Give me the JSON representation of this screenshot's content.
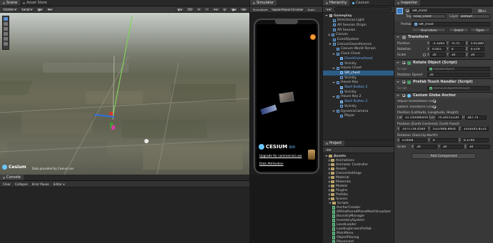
{
  "scene_panel": {
    "tabs": [
      "Scene",
      "Asset Store"
    ],
    "toolbar": [
      "Center",
      "Local"
    ],
    "view_2d": "2D",
    "attribution": "Data provided by Cesium ion",
    "cesium_logo": "Cesium"
  },
  "simulator_panel": {
    "tab": "Simulator",
    "device_label": "Simulator",
    "device": "Apple iPhone 12 mini",
    "scale_label": "Scale",
    "cesium_brand": "CESIUM",
    "ion": "ion",
    "upgrade_text": "Upgrade for commercial use",
    "data_attribution": "Data Attribution"
  },
  "hierarchy_panel": {
    "tab": "Hierarchy",
    "secondary_tab": "Cesium",
    "items": [
      {
        "label": "Gameplay",
        "depth": 0,
        "expanded": true,
        "kind": "scene",
        "bold": true
      },
      {
        "label": "Directional Light",
        "depth": 1,
        "kind": "go"
      },
      {
        "label": "AR Session Origin",
        "depth": 1,
        "kind": "go"
      },
      {
        "label": "AR Session",
        "depth": 1,
        "kind": "go"
      },
      {
        "label": "Canvas",
        "depth": 1,
        "kind": "go",
        "collapsed": true
      },
      {
        "label": "EventSystem",
        "depth": 1,
        "kind": "go"
      },
      {
        "label": "CesiumGeoreference",
        "depth": 1,
        "kind": "go",
        "expanded": true
      },
      {
        "label": "Cesium World Terrain",
        "depth": 2,
        "kind": "go"
      },
      {
        "label": "Clock Chest",
        "depth": 2,
        "kind": "go",
        "expanded": true
      },
      {
        "label": "ChestGameAsset",
        "depth": 3,
        "kind": "prefab",
        "blue": true
      },
      {
        "label": "Vicinity",
        "depth": 3,
        "kind": "go"
      },
      {
        "label": "House Chest",
        "depth": 2,
        "kind": "go",
        "expanded": true
      },
      {
        "label": "SM_chest",
        "depth": 3,
        "kind": "prefab",
        "selected": true
      },
      {
        "label": "Vicinity",
        "depth": 3,
        "kind": "go"
      },
      {
        "label": "House Key",
        "depth": 2,
        "kind": "go",
        "expanded": true
      },
      {
        "label": "Start Button 2",
        "depth": 3,
        "kind": "prefab",
        "blue": true
      },
      {
        "label": "Vicinity",
        "depth": 3,
        "kind": "go"
      },
      {
        "label": "House Key 2",
        "depth": 2,
        "kind": "go",
        "expanded": true
      },
      {
        "label": "Start Button 2",
        "depth": 3,
        "kind": "prefab",
        "blue": true
      },
      {
        "label": "Vicinity",
        "depth": 3,
        "kind": "go"
      },
      {
        "label": "DynamicCamera",
        "depth": 2,
        "kind": "go",
        "expanded": true
      },
      {
        "label": "Player",
        "depth": 3,
        "kind": "go"
      }
    ]
  },
  "project_panel": {
    "tab": "Project",
    "add": "+",
    "tree": [
      {
        "label": "Assets",
        "depth": 0,
        "expanded": true,
        "bold": true
      },
      {
        "label": "Animations",
        "depth": 1
      },
      {
        "label": "Animator Controller",
        "depth": 1
      },
      {
        "label": "Assets",
        "depth": 1
      },
      {
        "label": "CesiumSettings",
        "depth": 1
      },
      {
        "label": "Material",
        "depth": 1
      },
      {
        "label": "Materials",
        "depth": 1
      },
      {
        "label": "Models",
        "depth": 1
      },
      {
        "label": "Plugins",
        "depth": 1
      },
      {
        "label": "Prefabs",
        "depth": 1
      },
      {
        "label": "Scenes",
        "depth": 1
      },
      {
        "label": "Scripts",
        "depth": 1,
        "expanded": true
      },
      {
        "label": "AnchorCreator",
        "depth": 2,
        "script": true
      },
      {
        "label": "ARFeatheredPlaneMeshVisualizer",
        "depth": 2,
        "script": true
      },
      {
        "label": "BoundryManager",
        "depth": 2,
        "script": true
      },
      {
        "label": "InventorySystem",
        "depth": 2,
        "script": true
      },
      {
        "label": "LevelLoader",
        "depth": 2,
        "script": true
      },
      {
        "label": "LoadingScreenPrefab",
        "depth": 2,
        "script": true
      },
      {
        "label": "MainMenu",
        "depth": 2,
        "script": true
      },
      {
        "label": "ObjectPlacing",
        "depth": 2,
        "script": true
      },
      {
        "label": "Placement",
        "depth": 2,
        "script": true
      }
    ]
  },
  "console_panel": {
    "tab": "Console",
    "buttons": [
      "Clear",
      "Collapse",
      "Error Pause",
      "Editor"
    ]
  },
  "inspector": {
    "tab": "Inspector",
    "object_name": "SM_chest",
    "static_label": "Static",
    "tag_label": "Tag",
    "tag_value": "Final_Chest",
    "layer_label": "Layer",
    "layer_value": "Default",
    "prefab_label": "Prefab",
    "prefab_value": "SM_chest",
    "overrides_label": "Overrides",
    "select_label": "Select",
    "open_label": "Open",
    "transform": {
      "title": "Transform",
      "position_label": "Position",
      "rotation_label": "Rotation",
      "scale_label": "Scale",
      "position": {
        "x": "-2.32831",
        "y": "-0.75",
        "z": "5.91389"
      },
      "rotation": {
        "x": "0.001",
        "y": "0",
        "z": "0.379"
      },
      "scale": {
        "x": "30",
        "y": "30",
        "z": "30"
      }
    },
    "rotate": {
      "title": "Rotate Object (Script)",
      "script_label": "Script",
      "script_value": "RotateObject",
      "speed_label": "Rotation Speed",
      "speed_value": "30"
    },
    "prefab_touch": {
      "title": "Prefab Touch Handler (Script)",
      "script_label": "Script",
      "script_value": "RemoveObjectOnTouch"
    },
    "anchor": {
      "title": "Cesium Globe Anchor",
      "adjust_label": "Adjust Orientation For G",
      "detect_label": "Detect Transform Chan",
      "llh_label": "Position (Latitude, Longitude, Height)",
      "lat_label": "Lat",
      "lat_value": "31.550446059",
      "lon_label": "Lon",
      "lon_value": "74.30151339",
      "h_label": "H",
      "h_value": "187.75",
      "ecef_label": "Position (Earth-Centered, Earth-Fixed)",
      "ecef_x": "1471718.4584",
      "ecef_y": "5337806.8924",
      "ecef_z": "3318145.8131",
      "rot_label": "Rotation (East-Up-North)",
      "rot": {
        "x": "0.0008",
        "y": "0",
        "z": "0.3794"
      },
      "scale_label": "Scale",
      "scale": {
        "x": "30",
        "y": "30",
        "z": "30"
      }
    },
    "add_component": "Add Component"
  },
  "colors": {
    "accent": "#2c5d87",
    "blue_text": "#6fb0ff",
    "panel": "#383838",
    "dark": "#191919"
  }
}
